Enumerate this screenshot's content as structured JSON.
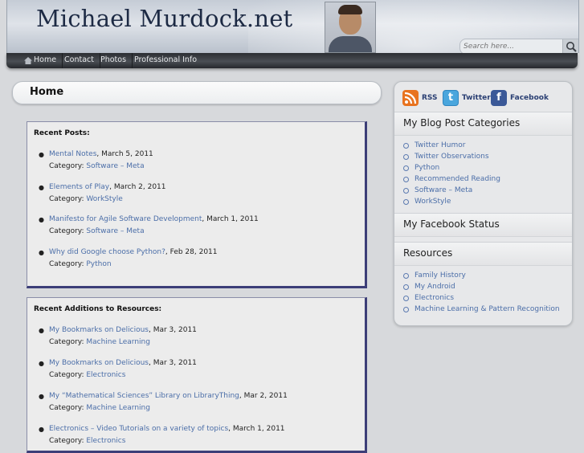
{
  "header": {
    "title": "Michael Murdock.net",
    "search_placeholder": "Search here..."
  },
  "nav": {
    "items": [
      "Home",
      "Contact",
      "Photos",
      "Professional Info"
    ]
  },
  "page": {
    "heading": "Home"
  },
  "recent_posts": {
    "heading": "Recent Posts:",
    "category_label": "Category: ",
    "items": [
      {
        "title": "Mental Notes",
        "date": ", March 5, 2011",
        "category": "Software – Meta"
      },
      {
        "title": "Elements of Play",
        "date": ", March 2, 2011",
        "category": "WorkStyle"
      },
      {
        "title": "Manifesto for Agile Software Development",
        "date": ", March 1, 2011",
        "category": "Software – Meta"
      },
      {
        "title": "Why did Google choose Python?",
        "date": ", Feb 28, 2011",
        "category": "Python"
      }
    ]
  },
  "recent_resources": {
    "heading": "Recent Additions to Resources:",
    "category_label": "Category: ",
    "items": [
      {
        "title": "My Bookmarks on Delicious",
        "date": ", Mar 3, 2011",
        "category": "Machine Learning"
      },
      {
        "title": "My Bookmarks on Delicious",
        "date": ", Mar 3, 2011",
        "category": "Electronics"
      },
      {
        "title": "My “Mathematical Sciences” Library on LibraryThing",
        "date": ", Mar 2, 2011",
        "category": "Machine Learning"
      },
      {
        "title": "Electronics – Video Tutorials on a variety of topics",
        "date": ", March 1, 2011",
        "category": "Electronics"
      }
    ]
  },
  "sidebar": {
    "social": [
      {
        "label": "RSS",
        "icon": "rss-icon",
        "color": "#e8731f"
      },
      {
        "label": "Twitter",
        "icon": "twitter-icon",
        "color": "#4aa6dd"
      },
      {
        "label": "Facebook",
        "icon": "facebook-icon",
        "color": "#3b5998"
      }
    ],
    "categories_heading": "My Blog Post Categories",
    "categories": [
      "Twitter Humor",
      "Twitter Observations",
      "Python",
      "Recommended Reading",
      "Software – Meta",
      "WorkStyle"
    ],
    "facebook_heading": "My Facebook Status",
    "resources_heading": "Resources",
    "resources": [
      "Family History",
      "My Android",
      "Electronics",
      "Machine Learning & Pattern Recognition"
    ]
  }
}
